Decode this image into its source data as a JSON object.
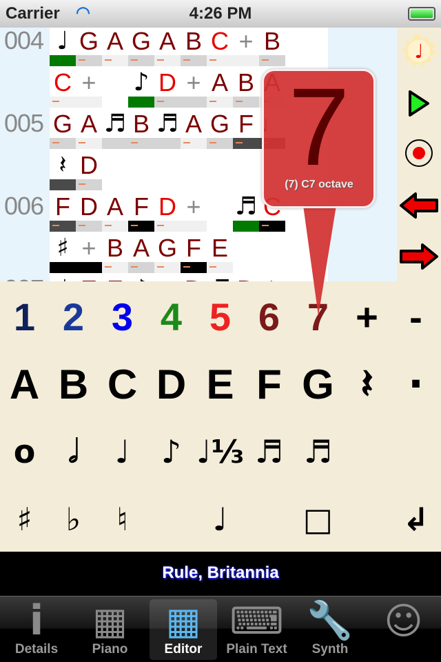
{
  "status": {
    "carrier": "Carrier",
    "time": "4:26 PM",
    "battery_level": 1.0
  },
  "score": {
    "rows": [
      {
        "line": "004",
        "cells": [
          {
            "t": "♩",
            "c": "blk",
            "bar": "green"
          },
          {
            "t": "G",
            "c": "dk",
            "bar": "light",
            "d": 1
          },
          {
            "t": "A",
            "c": "dk",
            "bar": "pale",
            "d": 1
          },
          {
            "t": "G",
            "c": "dk",
            "bar": "light",
            "d": 1
          },
          {
            "t": "A",
            "c": "dk",
            "bar": "pale",
            "d": 1
          },
          {
            "t": "B",
            "c": "dk",
            "bar": "light",
            "d": 1
          },
          {
            "t": "C",
            "c": "red",
            "bar": "pale",
            "d": 1
          },
          {
            "t": "+",
            "c": "gray",
            "bar": "pale"
          },
          {
            "t": "B",
            "c": "dk",
            "bar": "light",
            "d": 1
          }
        ]
      },
      {
        "line": "",
        "cells": [
          {
            "t": "C",
            "c": "red",
            "bar": "pale",
            "d": 1
          },
          {
            "t": "+",
            "c": "gray",
            "bar": "pale"
          },
          {
            "t": "",
            "c": "blk",
            "bar": "none"
          },
          {
            "t": "♪",
            "c": "blk",
            "bar": "green"
          },
          {
            "t": "D",
            "c": "red",
            "bar": "light",
            "d": 1
          },
          {
            "t": "+",
            "c": "gray",
            "bar": "light"
          },
          {
            "t": "A",
            "c": "dk",
            "bar": "pale",
            "d": 1
          },
          {
            "t": "B",
            "c": "dk",
            "bar": "light",
            "d": 1
          },
          {
            "t": "A",
            "c": "dk",
            "bar": "pale",
            "d": 1
          }
        ]
      },
      {
        "line": "005",
        "cells": [
          {
            "t": "G",
            "c": "dk",
            "bar": "light",
            "d": 1
          },
          {
            "t": "A",
            "c": "dk",
            "bar": "pale",
            "d": 1
          },
          {
            "t": "♬",
            "c": "blk",
            "bar": "light"
          },
          {
            "t": "B",
            "c": "dk",
            "bar": "light",
            "d": 1
          },
          {
            "t": "♬",
            "c": "blk",
            "bar": "light"
          },
          {
            "t": "A",
            "c": "dk",
            "bar": "pale",
            "d": 1
          },
          {
            "t": "G",
            "c": "dk",
            "bar": "light",
            "d": 1
          },
          {
            "t": "F",
            "c": "dk",
            "bar": "dark",
            "d": 1
          },
          {
            "t": "♩",
            "c": "dk",
            "bar": "dark",
            "d": 1
          }
        ]
      },
      {
        "line": "",
        "cells": [
          {
            "t": "𝄽",
            "c": "blk",
            "bar": "dark"
          },
          {
            "t": "D",
            "c": "dk",
            "bar": "light",
            "d": 1
          }
        ]
      },
      {
        "line": "006",
        "cells": [
          {
            "t": "F",
            "c": "dk",
            "bar": "dark",
            "d": 1
          },
          {
            "t": "D",
            "c": "dk",
            "bar": "light",
            "d": 1
          },
          {
            "t": "A",
            "c": "dk",
            "bar": "pale",
            "d": 1
          },
          {
            "t": "F",
            "c": "dk",
            "bar": "black",
            "d": 1
          },
          {
            "t": "D",
            "c": "red",
            "bar": "pale",
            "d": 1
          },
          {
            "t": "+",
            "c": "gray",
            "bar": "pale"
          },
          {
            "t": "",
            "c": "blk",
            "bar": "none"
          },
          {
            "t": "♬",
            "c": "blk",
            "bar": "green"
          },
          {
            "t": "C",
            "c": "red",
            "bar": "black",
            "d": 1
          }
        ]
      },
      {
        "line": "",
        "cells": [
          {
            "t": "♯",
            "c": "blk",
            "bar": "black"
          },
          {
            "t": "+",
            "c": "gray",
            "bar": "black"
          },
          {
            "t": "B",
            "c": "dk",
            "bar": "pale",
            "d": 1
          },
          {
            "t": "A",
            "c": "dk",
            "bar": "light",
            "d": 1
          },
          {
            "t": "G",
            "c": "dk",
            "bar": "pale",
            "d": 1
          },
          {
            "t": "F",
            "c": "dk",
            "bar": "black",
            "d": 1
          },
          {
            "t": "E",
            "c": "dk",
            "bar": "pale",
            "d": 1
          }
        ]
      },
      {
        "line": "007",
        "cells": [
          {
            "t": "♩",
            "c": "blk",
            "bar": "none"
          },
          {
            "t": "E",
            "c": "dk",
            "bar": "none"
          },
          {
            "t": "E",
            "c": "dk",
            "bar": "none"
          },
          {
            "t": "♪",
            "c": "blk",
            "bar": "none"
          },
          {
            "t": "",
            "c": "blk",
            "bar": "none"
          },
          {
            "t": "D",
            "c": "dk",
            "bar": "none"
          },
          {
            "t": "♬",
            "c": "blk",
            "bar": "none"
          },
          {
            "t": "D",
            "c": "dk",
            "bar": "none"
          },
          {
            "t": "𝄽",
            "c": "blk",
            "bar": "none"
          }
        ]
      }
    ]
  },
  "bar_colors": {
    "green": "#007a00",
    "light": "#d4d4d4",
    "pale": "#f0f0f0",
    "dark": "#4a4a4a",
    "black": "#000000",
    "none": "transparent"
  },
  "toolbar": [
    {
      "icon": "note-sun-icon",
      "glyph": "♩"
    },
    {
      "icon": "play-icon"
    },
    {
      "icon": "record-icon"
    },
    {
      "icon": "arrow-left-icon"
    },
    {
      "icon": "arrow-right-icon"
    }
  ],
  "popover": {
    "digit": "7",
    "label": "(7) C7 octave"
  },
  "keyboard": [
    [
      {
        "t": "1",
        "color": "#10205a"
      },
      {
        "t": "2",
        "color": "#1a3a9a"
      },
      {
        "t": "3",
        "color": "#0000ee"
      },
      {
        "t": "4",
        "color": "#1a8a1a"
      },
      {
        "t": "5",
        "color": "#ee2222"
      },
      {
        "t": "6",
        "color": "#7a1a1a"
      },
      {
        "t": "7",
        "color": "#7a1a1a"
      },
      {
        "t": "+",
        "color": "#000"
      },
      {
        "t": "-",
        "color": "#000"
      }
    ],
    [
      {
        "t": "A"
      },
      {
        "t": "B"
      },
      {
        "t": "C"
      },
      {
        "t": "D"
      },
      {
        "t": "E"
      },
      {
        "t": "F"
      },
      {
        "t": "G"
      },
      {
        "t": "𝄽"
      },
      {
        "t": "·"
      }
    ],
    [
      {
        "t": "o"
      },
      {
        "t": "𝅗𝅥"
      },
      {
        "t": "♩"
      },
      {
        "t": "♪"
      },
      {
        "t": "♩⅓"
      },
      {
        "t": "♬"
      },
      {
        "t": "♬"
      },
      {
        "t": ""
      },
      {
        "t": ""
      }
    ],
    [
      {
        "t": "♯"
      },
      {
        "t": "♭"
      },
      {
        "t": "♮"
      },
      {
        "t": ""
      },
      {
        "t": "♩"
      },
      {
        "t": ""
      },
      {
        "t": "□"
      },
      {
        "t": ""
      },
      {
        "t": "↲"
      }
    ]
  ],
  "song_title": "Rule, Britannia",
  "tabs": [
    {
      "label": "Details",
      "icon": "info-icon",
      "glyph": "i"
    },
    {
      "label": "Piano",
      "icon": "piano-icon",
      "glyph": "▦"
    },
    {
      "label": "Editor",
      "icon": "editor-grid-icon",
      "glyph": "▦",
      "selected": true
    },
    {
      "label": "Plain Text",
      "icon": "keyboard-icon",
      "glyph": "⌨"
    },
    {
      "label": "Synth",
      "icon": "wrench-icon",
      "glyph": "🔧"
    },
    {
      "label": "",
      "icon": "smiley-icon",
      "glyph": "☺"
    }
  ]
}
